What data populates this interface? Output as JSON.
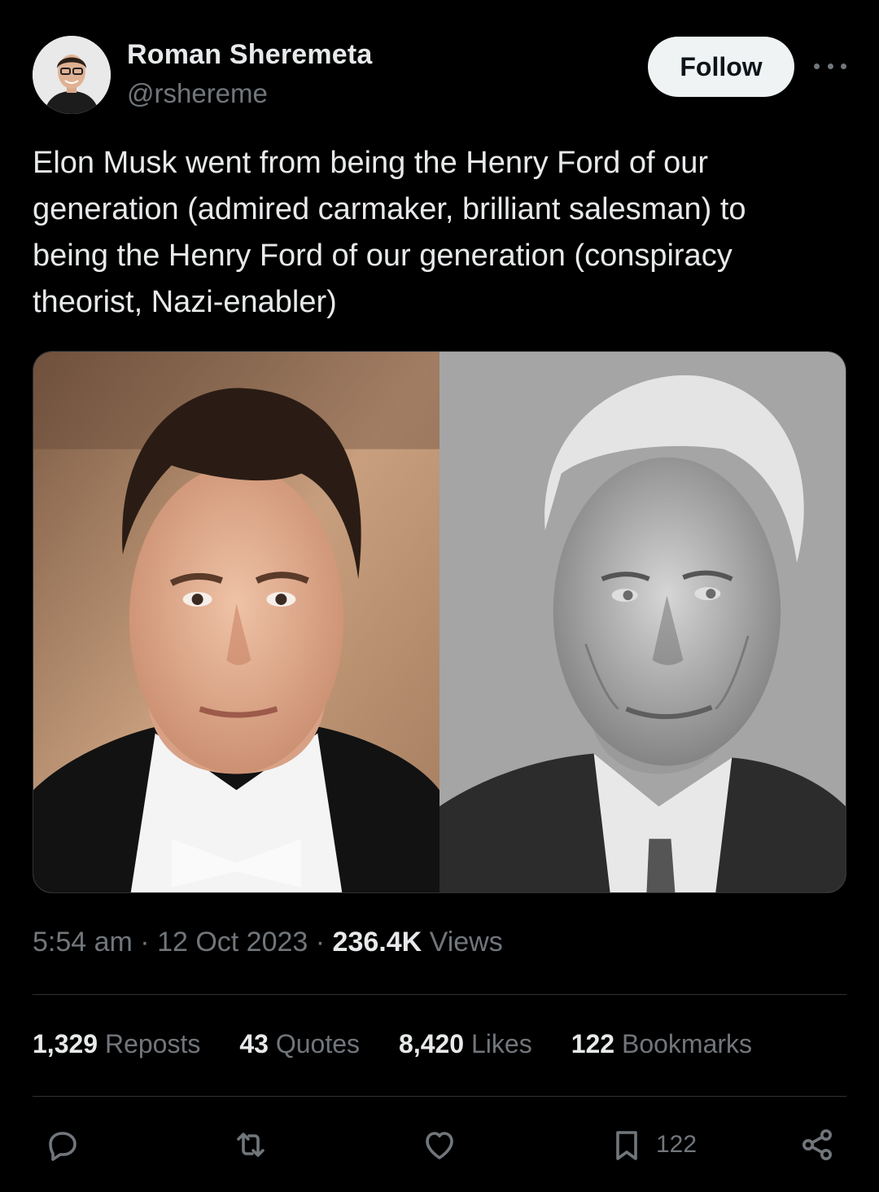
{
  "author": {
    "name": "Roman Sheremeta",
    "handle": "@rshereme"
  },
  "header": {
    "follow_label": "Follow"
  },
  "tweet": {
    "text": "Elon Musk went from being the Henry Ford of our\ngeneration (admired carmaker, brilliant salesman) to\nbeing the Henry Ford of our generation (conspiracy\ntheorist, Nazi-enabler)"
  },
  "meta": {
    "time": "5:54 am",
    "sep1": " · ",
    "date": "12 Oct 2023",
    "sep2": " · ",
    "views_count": "236.4K",
    "views_label": " Views"
  },
  "stats": {
    "reposts_count": "1,329",
    "reposts_label": " Reposts",
    "quotes_count": "43",
    "quotes_label": " Quotes",
    "likes_count": "8,420",
    "likes_label": " Likes",
    "bookmarks_count": "122",
    "bookmarks_label": " Bookmarks"
  },
  "actions": {
    "bookmark_count": "122"
  },
  "icons": {
    "more": "more-icon",
    "reply": "reply-icon",
    "repost": "repost-icon",
    "like": "heart-icon",
    "bookmark": "bookmark-icon",
    "share": "share-icon"
  },
  "colors": {
    "background": "#000000",
    "text": "#e7e9ea",
    "muted": "#71767b",
    "divider": "#2f3336",
    "follow_bg": "#eff3f4"
  }
}
